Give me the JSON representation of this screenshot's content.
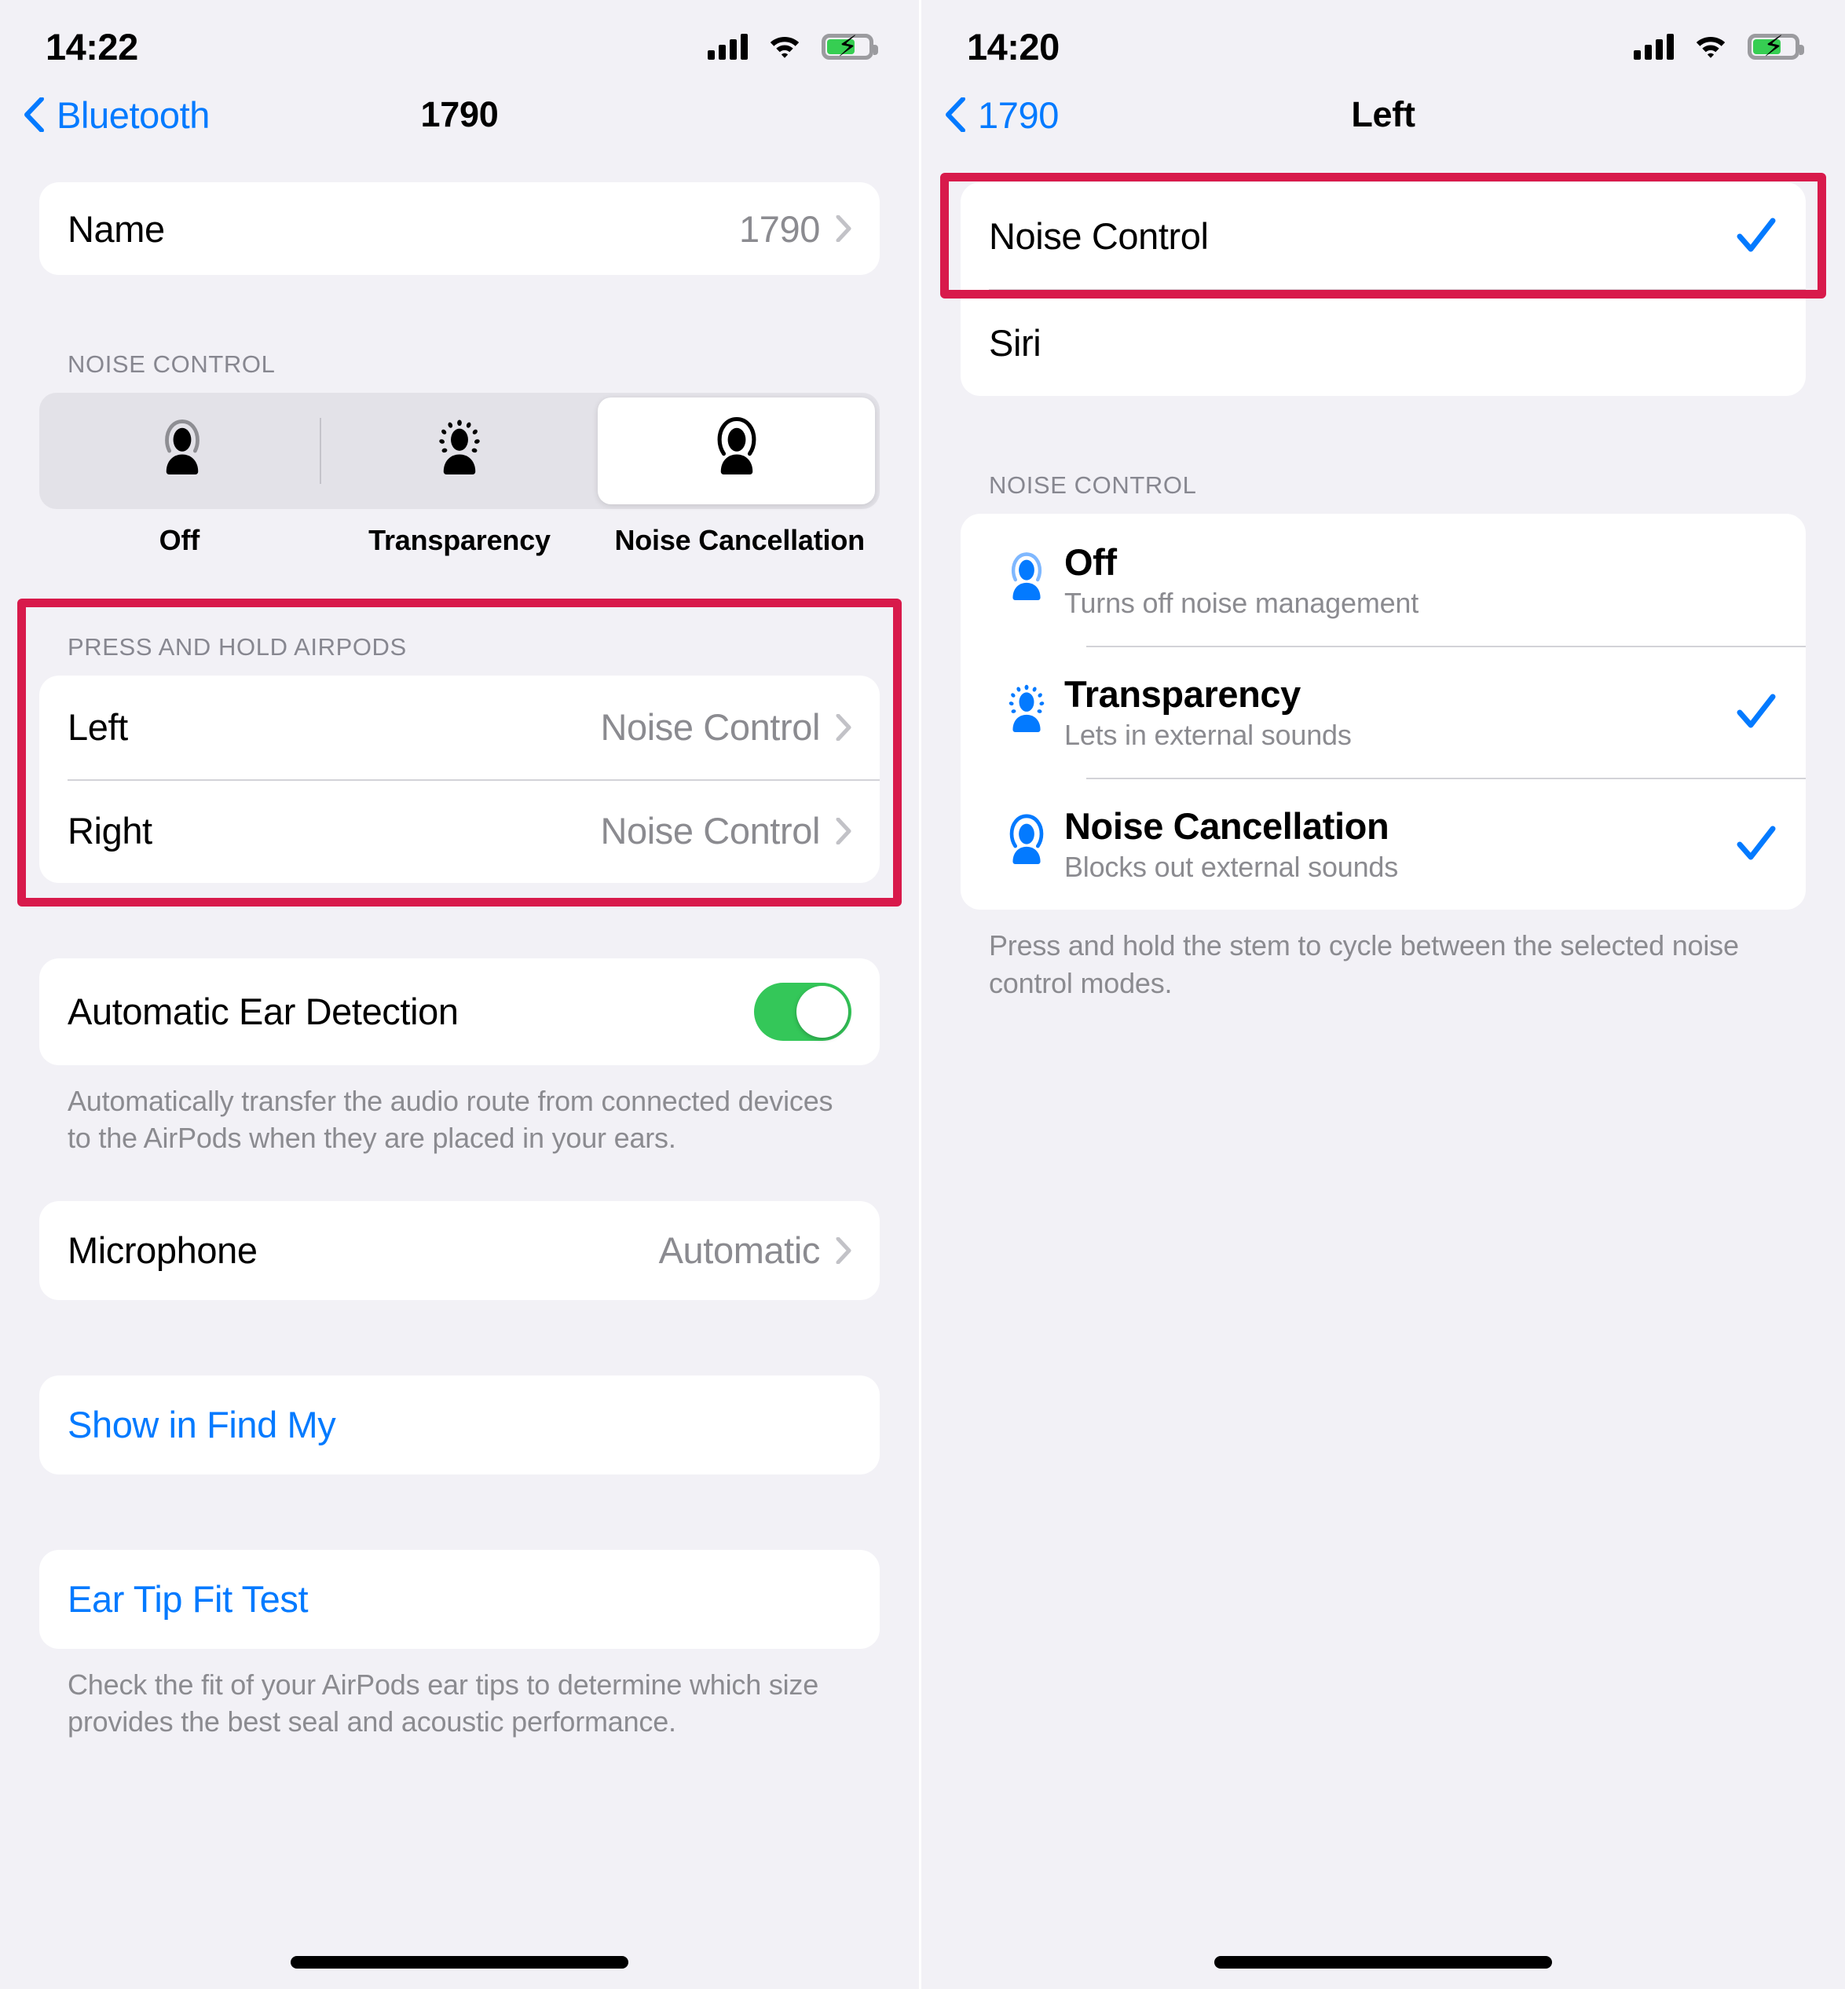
{
  "left_screen": {
    "status": {
      "time": "14:22",
      "signal_icon": "cellular-bars-icon",
      "wifi_icon": "wifi-icon",
      "battery_icon": "battery-charging-icon"
    },
    "nav": {
      "back_label": "Bluetooth",
      "back_icon": "chevron-left-icon",
      "title": "1790"
    },
    "name_row": {
      "label": "Name",
      "value": "1790",
      "chevron_icon": "chevron-right-icon"
    },
    "noise_control": {
      "header": "NOISE CONTROL",
      "options": [
        {
          "label": "Off",
          "icon": "person-noise-off-icon",
          "selected": false
        },
        {
          "label": "Transparency",
          "icon": "person-transparency-icon",
          "selected": false
        },
        {
          "label": "Noise Cancellation",
          "icon": "person-noise-cancellation-icon",
          "selected": true
        }
      ]
    },
    "press_hold": {
      "header": "PRESS AND HOLD AIRPODS",
      "rows": [
        {
          "label": "Left",
          "value": "Noise Control",
          "chevron_icon": "chevron-right-icon"
        },
        {
          "label": "Right",
          "value": "Noise Control",
          "chevron_icon": "chevron-right-icon"
        }
      ]
    },
    "ear_detection": {
      "label": "Automatic Ear Detection",
      "toggle_state": "on",
      "footnote": "Automatically transfer the audio route from connected devices to the AirPods when they are placed in your ears."
    },
    "microphone": {
      "label": "Microphone",
      "value": "Automatic",
      "chevron_icon": "chevron-right-icon"
    },
    "find_my": {
      "label": "Show in Find My"
    },
    "ear_tip": {
      "label": "Ear Tip Fit Test",
      "footnote": "Check the fit of your AirPods ear tips to determine which size provides the best seal and acoustic performance."
    }
  },
  "right_screen": {
    "status": {
      "time": "14:20",
      "signal_icon": "cellular-bars-icon",
      "wifi_icon": "wifi-icon",
      "battery_icon": "battery-charging-icon"
    },
    "nav": {
      "back_label": "1790",
      "back_icon": "chevron-left-icon",
      "title": "Left"
    },
    "action_options": [
      {
        "label": "Noise Control",
        "selected": true,
        "check_icon": "checkmark-icon"
      },
      {
        "label": "Siri",
        "selected": false
      }
    ],
    "noise_control": {
      "header": "NOISE CONTROL",
      "modes": [
        {
          "title": "Off",
          "subtitle": "Turns off noise management",
          "icon": "person-noise-off-icon",
          "selected": false
        },
        {
          "title": "Transparency",
          "subtitle": "Lets in external sounds",
          "icon": "person-transparency-icon",
          "selected": true,
          "check_icon": "checkmark-icon"
        },
        {
          "title": "Noise Cancellation",
          "subtitle": "Blocks out external sounds",
          "icon": "person-noise-cancellation-icon",
          "selected": true,
          "check_icon": "checkmark-icon"
        }
      ],
      "footnote": "Press and hold the stem to cycle between the selected noise control modes."
    }
  },
  "colors": {
    "accent_blue": "#037AFF",
    "toggle_green": "#34C759",
    "annotation_red": "#D81A4B",
    "secondary_text": "#8b8b90",
    "background": "#f2f1f6"
  }
}
